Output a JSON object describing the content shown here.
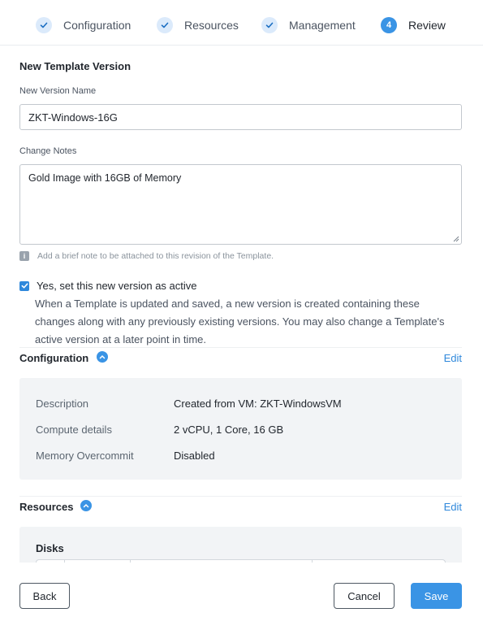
{
  "stepper": {
    "steps": [
      {
        "label": "Configuration",
        "state": "done"
      },
      {
        "label": "Resources",
        "state": "done"
      },
      {
        "label": "Management",
        "state": "done"
      },
      {
        "label": "Review",
        "number": "4",
        "state": "current"
      }
    ]
  },
  "form": {
    "title": "New Template Version",
    "version_name_label": "New Version Name",
    "version_name_value": "ZKT-Windows-16G",
    "change_notes_label": "Change Notes",
    "change_notes_value": "Gold Image with 16GB of Memory",
    "change_notes_hint": "Add a brief note to be attached to this revision of the Template.",
    "set_active_label": "Yes, set this new version as active",
    "set_active_checked": true,
    "set_active_description": "When a Template is updated and saved, a new version is created containing these changes along with any previously existing versions. You may also change a Template's active version at a later point in time."
  },
  "configuration": {
    "title": "Configuration",
    "edit_label": "Edit",
    "rows": [
      {
        "key": "Description",
        "value": "Created from VM: ZKT-WindowsVM"
      },
      {
        "key": "Compute details",
        "value": "2 vCPU, 1 Core, 16 GB"
      },
      {
        "key": "Memory Overcommit",
        "value": "Disabled"
      }
    ]
  },
  "resources": {
    "title": "Resources",
    "edit_label": "Edit",
    "disks_label": "Disks"
  },
  "footer": {
    "back_label": "Back",
    "cancel_label": "Cancel",
    "save_label": "Save"
  },
  "colors": {
    "accent": "#3a94e5",
    "link": "#2f88db",
    "panel_bg": "#f2f4f6"
  },
  "icons": {
    "step_done": "check-icon",
    "section_toggle": "chevron-up-icon",
    "hint": "info-icon",
    "checkbox": "checkbox-checked-icon"
  }
}
